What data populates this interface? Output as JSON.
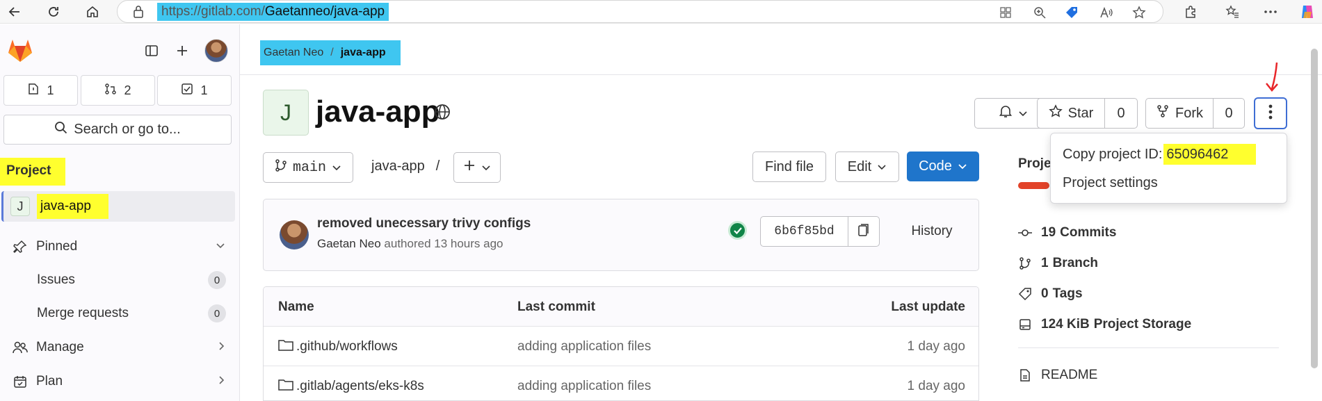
{
  "browser": {
    "url_prefix": "https://gitlab.com/",
    "url_path": "Gaetanneo/java-app"
  },
  "sidebar": {
    "counters": [
      {
        "icon": "issues-icon",
        "count": "1"
      },
      {
        "icon": "merge-request-icon",
        "count": "2"
      },
      {
        "icon": "todo-icon",
        "count": "1"
      }
    ],
    "search_label": "Search or go to...",
    "section_label": "Project",
    "project_initial": "J",
    "project_name": "java-app",
    "pinned_label": "Pinned",
    "pinned_items": [
      {
        "label": "Issues",
        "count": "0"
      },
      {
        "label": "Merge requests",
        "count": "0"
      }
    ],
    "manage_label": "Manage",
    "plan_label": "Plan"
  },
  "breadcrumb": {
    "owner": "Gaetan Neo",
    "separator": "/",
    "project": "java-app"
  },
  "project": {
    "initial": "J",
    "title": "java-app",
    "star_label": "Star",
    "star_count": "0",
    "fork_label": "Fork",
    "fork_count": "0"
  },
  "more_menu": {
    "copy_id_label": "Copy project ID:",
    "project_id": "65096462",
    "settings_label": "Project settings"
  },
  "repo_toolbar": {
    "branch": "main",
    "path": "java-app",
    "path_sep": "/",
    "find_file": "Find file",
    "edit": "Edit",
    "code": "Code"
  },
  "last_commit": {
    "title": "removed unecessary trivy configs",
    "author": "Gaetan Neo",
    "authored_text": "authored 13 hours ago",
    "sha": "6b6f85bd",
    "history": "History"
  },
  "file_table": {
    "headers": [
      "Name",
      "Last commit",
      "Last update"
    ],
    "rows": [
      {
        "name": ".github/workflows",
        "commit": "adding application files",
        "updated": "1 day ago"
      },
      {
        "name": ".gitlab/agents/eks-k8s",
        "commit": "adding application files",
        "updated": "1 day ago"
      }
    ]
  },
  "project_info": {
    "title_visible": "Proje",
    "stats": [
      {
        "icon": "commit-icon",
        "value": "19",
        "label": "Commits"
      },
      {
        "icon": "branch-icon",
        "value": "1",
        "label": "Branch"
      },
      {
        "icon": "tag-icon",
        "value": "0",
        "label": "Tags"
      },
      {
        "icon": "storage-icon",
        "value": "124 KiB",
        "label": "Project Storage"
      }
    ],
    "readme": "README"
  },
  "colors": {
    "primary": "#1f75cb",
    "highlight_yellow": "#ffff2e",
    "highlight_cyan": "#3fc6f0",
    "annotation_red": "#e8262a",
    "success": "#108548"
  }
}
